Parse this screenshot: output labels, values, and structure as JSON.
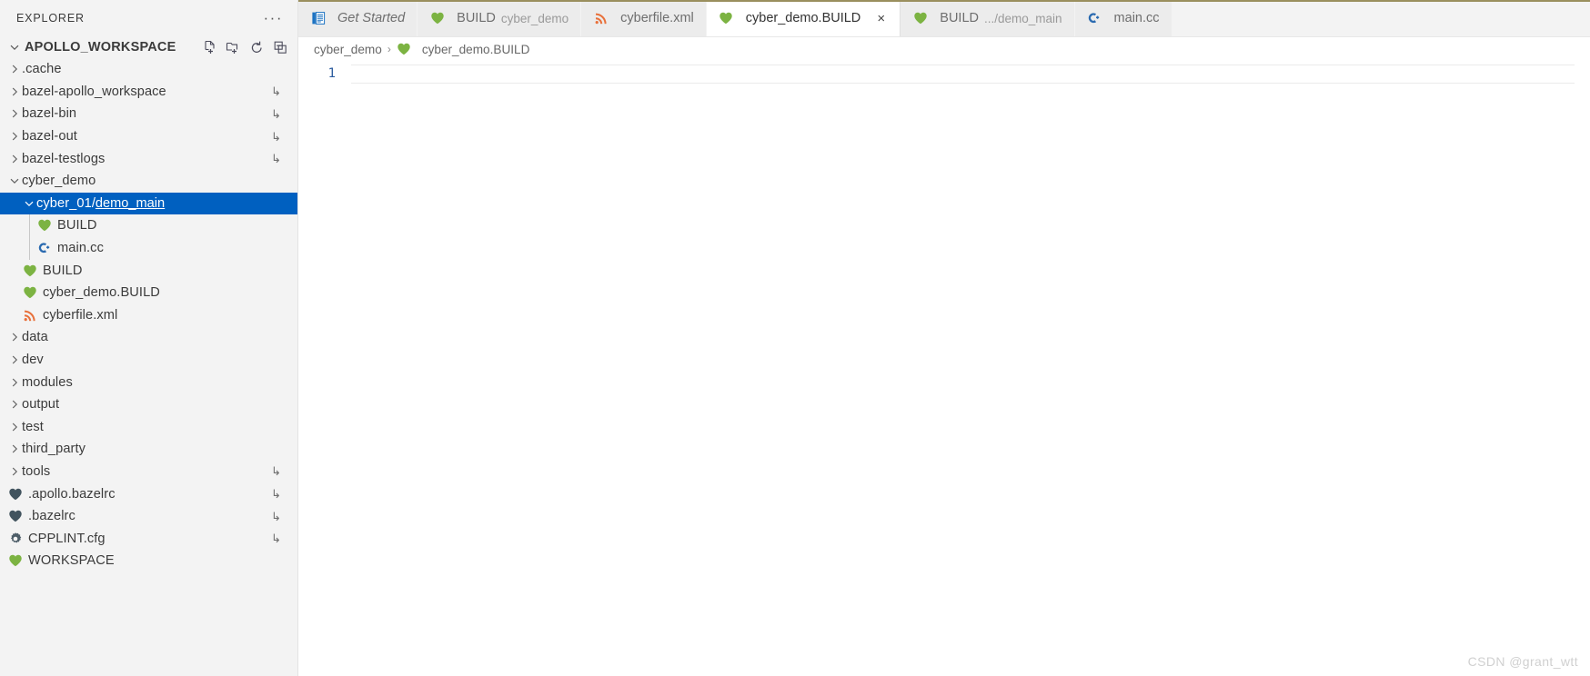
{
  "sidebar": {
    "title": "EXPLORER",
    "more_label": "···",
    "root": {
      "label": "APOLLO_WORKSPACE",
      "expanded": true,
      "actions": [
        {
          "name": "new-file-icon",
          "tooltip": "New File"
        },
        {
          "name": "new-folder-icon",
          "tooltip": "New Folder"
        },
        {
          "name": "refresh-icon",
          "tooltip": "Refresh Explorer"
        },
        {
          "name": "collapse-all-icon",
          "tooltip": "Collapse Folders in Explorer"
        }
      ]
    },
    "items": [
      {
        "label": ".cache",
        "type": "folder",
        "expanded": false,
        "indent": 0,
        "icon": "chevron-right",
        "symlink": false
      },
      {
        "label": "bazel-apollo_workspace",
        "type": "folder",
        "expanded": false,
        "indent": 0,
        "icon": "chevron-right",
        "symlink": true
      },
      {
        "label": "bazel-bin",
        "type": "folder",
        "expanded": false,
        "indent": 0,
        "icon": "chevron-right",
        "symlink": true
      },
      {
        "label": "bazel-out",
        "type": "folder",
        "expanded": false,
        "indent": 0,
        "icon": "chevron-right",
        "symlink": true
      },
      {
        "label": "bazel-testlogs",
        "type": "folder",
        "expanded": false,
        "indent": 0,
        "icon": "chevron-right",
        "symlink": true
      },
      {
        "label": "cyber_demo",
        "type": "folder",
        "expanded": true,
        "indent": 0,
        "icon": "chevron-down",
        "symlink": false
      },
      {
        "label": "cyber_01",
        "label2": "demo_main",
        "type": "folder",
        "expanded": true,
        "indent": 1,
        "icon": "chevron-down",
        "symlink": false,
        "selected": true,
        "compact": true
      },
      {
        "label": "BUILD",
        "type": "file",
        "indent": 2,
        "icon": "bazel-heart-green",
        "symlink": false
      },
      {
        "label": "main.cc",
        "type": "file",
        "indent": 2,
        "icon": "cpp-icon",
        "symlink": false
      },
      {
        "label": "BUILD",
        "type": "file",
        "indent": 1,
        "icon": "bazel-heart-green",
        "symlink": false
      },
      {
        "label": "cyber_demo.BUILD",
        "type": "file",
        "indent": 1,
        "icon": "bazel-heart-green",
        "symlink": false
      },
      {
        "label": "cyberfile.xml",
        "type": "file",
        "indent": 1,
        "icon": "xml-icon",
        "symlink": false
      },
      {
        "label": "data",
        "type": "folder",
        "expanded": false,
        "indent": 0,
        "icon": "chevron-right",
        "symlink": false
      },
      {
        "label": "dev",
        "type": "folder",
        "expanded": false,
        "indent": 0,
        "icon": "chevron-right",
        "symlink": false
      },
      {
        "label": "modules",
        "type": "folder",
        "expanded": false,
        "indent": 0,
        "icon": "chevron-right",
        "symlink": false
      },
      {
        "label": "output",
        "type": "folder",
        "expanded": false,
        "indent": 0,
        "icon": "chevron-right",
        "symlink": false
      },
      {
        "label": "test",
        "type": "folder",
        "expanded": false,
        "indent": 0,
        "icon": "chevron-right",
        "symlink": false
      },
      {
        "label": "third_party",
        "type": "folder",
        "expanded": false,
        "indent": 0,
        "icon": "chevron-right",
        "symlink": false
      },
      {
        "label": "tools",
        "type": "folder",
        "expanded": false,
        "indent": 0,
        "icon": "chevron-right",
        "symlink": true
      },
      {
        "label": ".apollo.bazelrc",
        "type": "file",
        "indent": 0,
        "icon": "bazel-heart-dark",
        "symlink": true
      },
      {
        "label": ".bazelrc",
        "type": "file",
        "indent": 0,
        "icon": "bazel-heart-dark",
        "symlink": true
      },
      {
        "label": "CPPLINT.cfg",
        "type": "file",
        "indent": 0,
        "icon": "gear-icon",
        "symlink": true
      },
      {
        "label": "WORKSPACE",
        "type": "file",
        "indent": 0,
        "icon": "bazel-heart-green",
        "symlink": false
      }
    ]
  },
  "tabs": [
    {
      "label": "Get Started",
      "desc": "",
      "icon": "get-started-icon",
      "active": false,
      "italic": true,
      "dirty": false
    },
    {
      "label": "BUILD",
      "desc": "cyber_demo",
      "icon": "bazel-heart-green",
      "active": false,
      "italic": false,
      "dirty": false
    },
    {
      "label": "cyberfile.xml",
      "desc": "",
      "icon": "xml-icon",
      "active": false,
      "italic": false,
      "dirty": false
    },
    {
      "label": "cyber_demo.BUILD",
      "desc": "",
      "icon": "bazel-heart-green",
      "active": true,
      "italic": false,
      "dirty": false,
      "close_label": "×"
    },
    {
      "label": "BUILD",
      "desc": ".../demo_main",
      "icon": "bazel-heart-green",
      "active": false,
      "italic": false,
      "dirty": false
    },
    {
      "label": "main.cc",
      "desc": "",
      "icon": "cpp-icon",
      "active": false,
      "italic": false,
      "dirty": false
    }
  ],
  "breadcrumbs": [
    {
      "label": "cyber_demo",
      "icon": ""
    },
    {
      "label": "cyber_demo.BUILD",
      "icon": "bazel-heart-green"
    }
  ],
  "breadcrumb_separator": "›",
  "editor": {
    "line_numbers": [
      "1"
    ],
    "lines": [
      ""
    ],
    "active_line": 1
  },
  "watermark": "CSDN @grant_wtt",
  "colors": {
    "selection_blue": "#0060c0",
    "sidebar_bg": "#f3f3f3",
    "tab_inactive_bg": "#ececec",
    "tab_active_bg": "#ffffff",
    "tabbar_top_accent": "#9a8f5e",
    "bazel_green": "#7cb342",
    "bazel_dark": "#41535e",
    "xml_orange": "#e8703a",
    "cpp_blue": "#2a6ab0",
    "linenum_blue": "#2b5b9e",
    "text": "#3b3b3b"
  }
}
